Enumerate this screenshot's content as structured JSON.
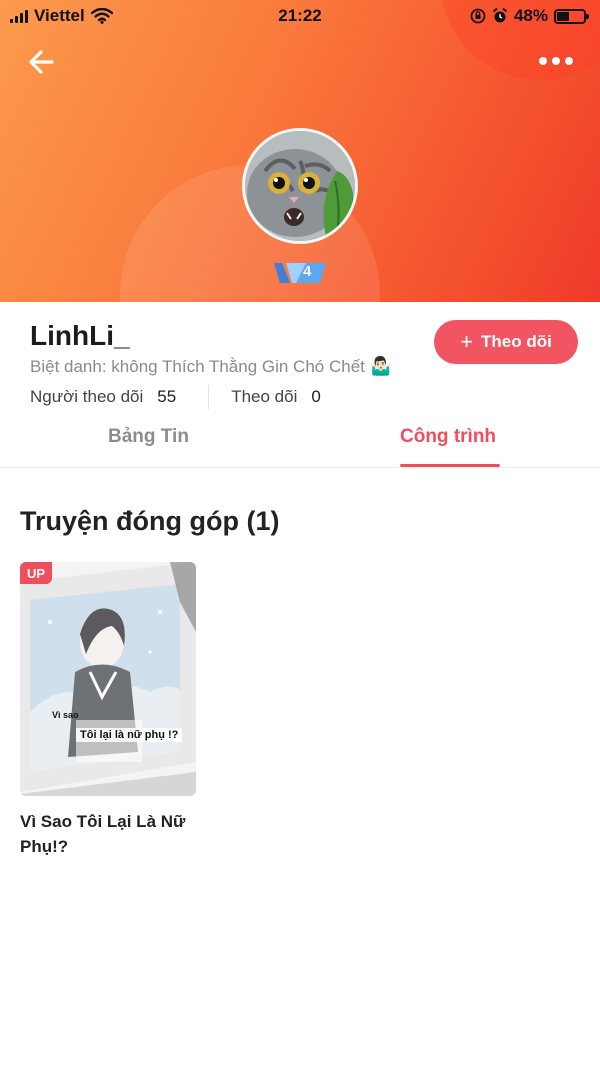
{
  "status_bar": {
    "carrier": "Viettel",
    "time": "21:22",
    "battery": "48%",
    "battery_level": 0.48
  },
  "profile": {
    "username": "LinhLi_",
    "nickname": "Biệt danh: không Thích Thằng Gin Chó Chết",
    "nickname_emoji": "🤷🏻‍♂️",
    "level": "4",
    "follow_button": "Theo dõi",
    "followers_label": "Người theo dõi",
    "followers_count": "55",
    "following_label": "Theo dõi",
    "following_count": "0"
  },
  "tabs": [
    {
      "label": "Bảng Tin",
      "active": false
    },
    {
      "label": "Công trình",
      "active": true
    }
  ],
  "section": {
    "title": "Truyện đóng góp (1)"
  },
  "stories": [
    {
      "badge": "UP",
      "title": "Vì Sao Tôi Lại Là Nữ Phụ!?",
      "cover_text_small": "Vì sao",
      "cover_text_main": "Tôi lại là nữ phụ !?"
    }
  ],
  "colors": {
    "accent": "#f04d5d",
    "follow_button": "#f25562",
    "hero_start": "#fb9a4c",
    "hero_end": "#ef3b2a"
  }
}
